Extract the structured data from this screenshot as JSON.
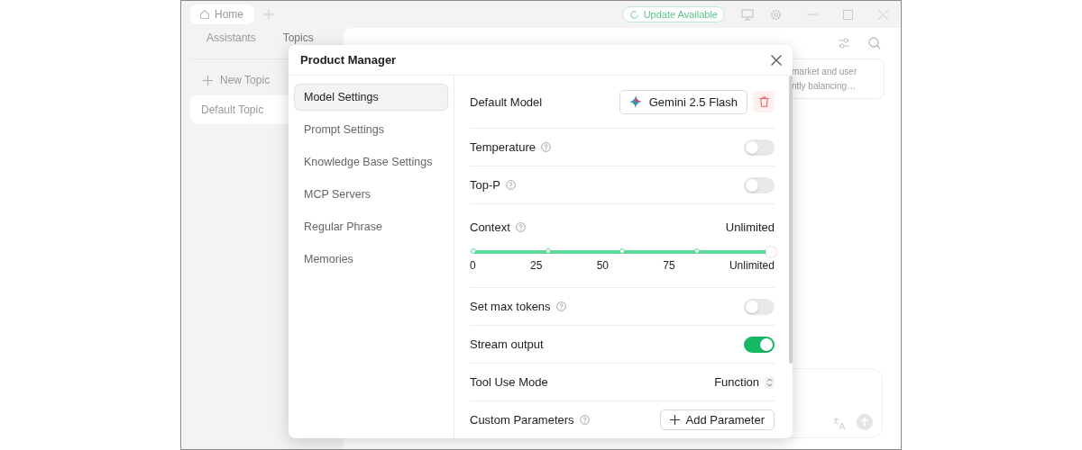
{
  "app": {
    "tabs": [
      {
        "label": "Home",
        "selected": true
      }
    ],
    "update_button": "Update Available",
    "sidebar_tabs": [
      {
        "label": "Assistants",
        "selected": false
      },
      {
        "label": "Topics",
        "selected": true
      }
    ],
    "new_topic": "New Topic",
    "topics": [
      {
        "label": "Default Topic",
        "selected": true
      }
    ],
    "message_preview": [
      "market and user",
      "ntly balancing…"
    ]
  },
  "dialog": {
    "title": "Product Manager",
    "nav": [
      {
        "label": "Model Settings",
        "selected": true
      },
      {
        "label": "Prompt Settings",
        "selected": false
      },
      {
        "label": "Knowledge Base Settings",
        "selected": false
      },
      {
        "label": "MCP Servers",
        "selected": false
      },
      {
        "label": "Regular Phrase",
        "selected": false
      },
      {
        "label": "Memories",
        "selected": false
      }
    ],
    "default_model": {
      "label": "Default Model",
      "model": "Gemini 2.5 Flash"
    },
    "settings": [
      {
        "kind": "toggle",
        "label": "Temperature",
        "help": true,
        "on": false
      },
      {
        "kind": "toggle",
        "label": "Top-P",
        "help": true,
        "on": false
      },
      {
        "kind": "slider",
        "label": "Context",
        "help": true,
        "value": "Unlimited",
        "level": 1,
        "ticks": [
          "0",
          "25",
          "50",
          "75",
          "Unlimited"
        ]
      },
      {
        "kind": "toggle",
        "label": "Set max tokens",
        "help": true,
        "on": false
      },
      {
        "kind": "toggle",
        "label": "Stream output",
        "help": false,
        "on": true
      },
      {
        "kind": "select",
        "label": "Tool Use Mode",
        "help": false,
        "value": "Function"
      },
      {
        "kind": "button",
        "label": "Custom Parameters",
        "help": true,
        "button": "Add Parameter"
      }
    ]
  }
}
